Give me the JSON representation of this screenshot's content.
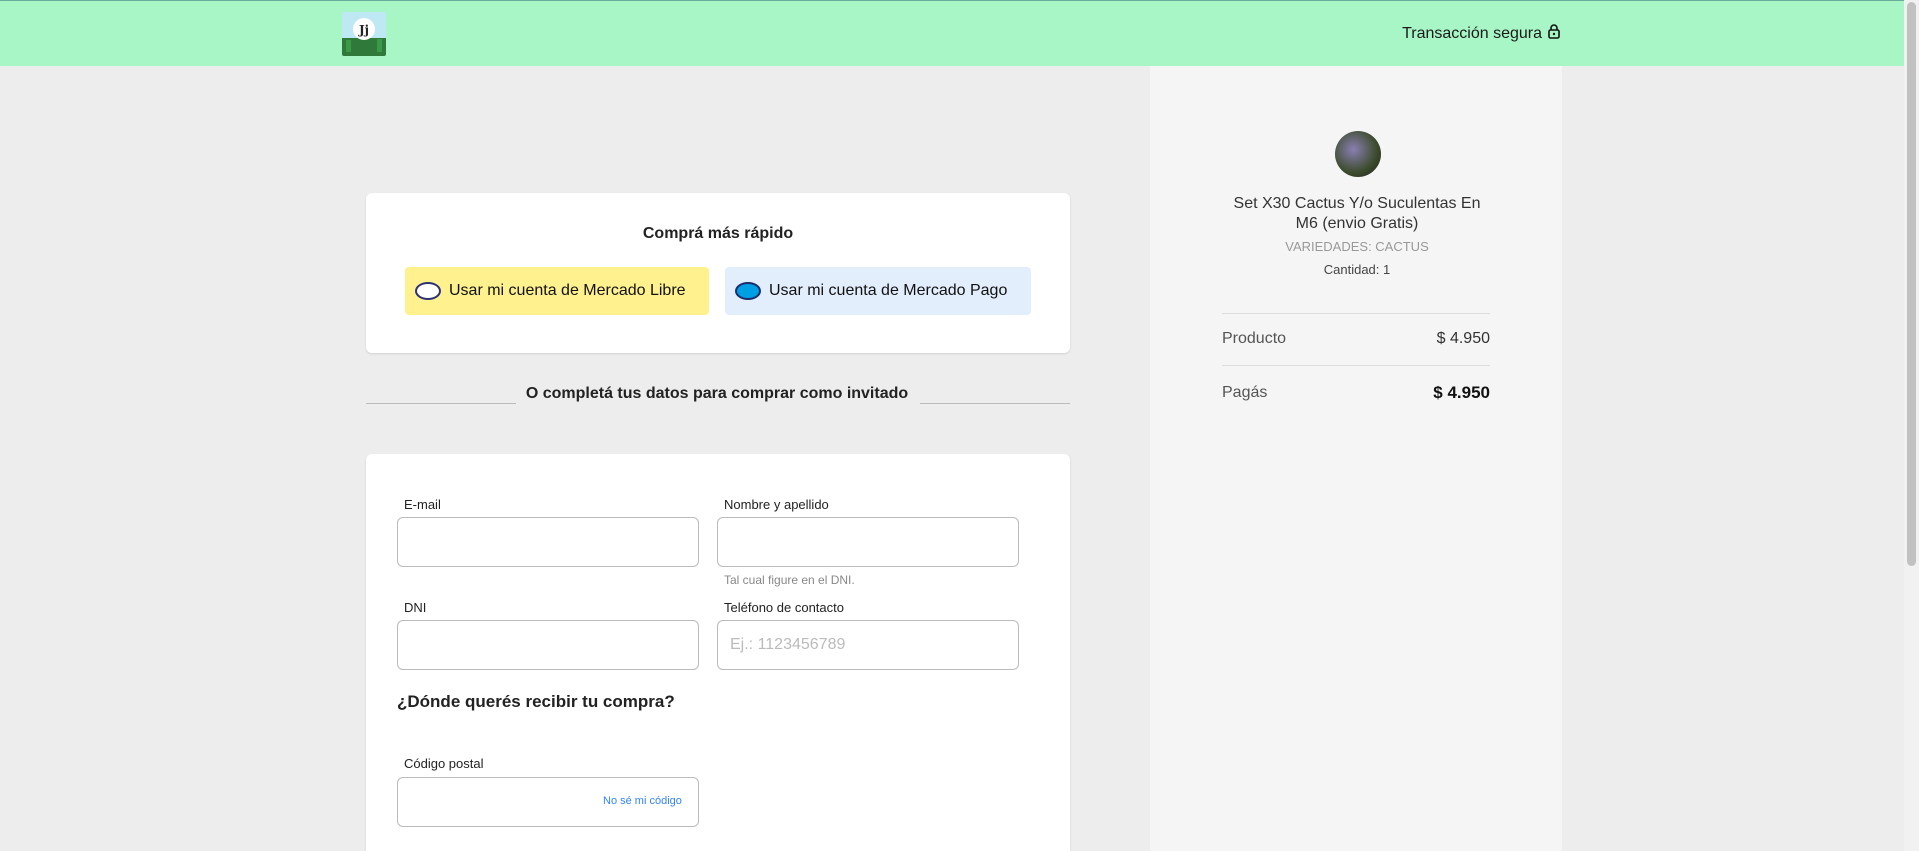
{
  "header": {
    "secure_label": "Transacción segura",
    "lock_icon": "lock-icon"
  },
  "fast_buy": {
    "title": "Comprá más rápido",
    "ml_button": "Usar mi cuenta de Mercado Libre",
    "mp_button": "Usar mi cuenta de Mercado Pago"
  },
  "guest": {
    "divider_text": "O completá tus datos para comprar como invitado"
  },
  "form": {
    "email_label": "E-mail",
    "email_value": "",
    "name_label": "Nombre y apellido",
    "name_value": "",
    "name_hint": "Tal cual figure en el DNI.",
    "dni_label": "DNI",
    "dni_value": "",
    "phone_label": "Teléfono de contacto",
    "phone_placeholder": "Ej.: 1123456789",
    "delivery_title": "¿Dónde querés recibir tu compra?",
    "postal_label": "Código postal",
    "postal_value": "",
    "postal_link": "No sé mi código"
  },
  "summary": {
    "product_title": "Set X30 Cactus Y/o Suculentas En M6 (envio Gratis)",
    "variant": "VARIEDADES: CACTUS",
    "quantity": "Cantidad: 1",
    "product_label": "Producto",
    "product_price": "$ 4.950",
    "total_label": "Pagás",
    "total_price": "$ 4.950"
  },
  "colors": {
    "header_bg": "#a8f6c6",
    "ml_button_bg": "#fff18e",
    "mp_button_bg": "#e3eefd",
    "link": "#3483fa"
  }
}
